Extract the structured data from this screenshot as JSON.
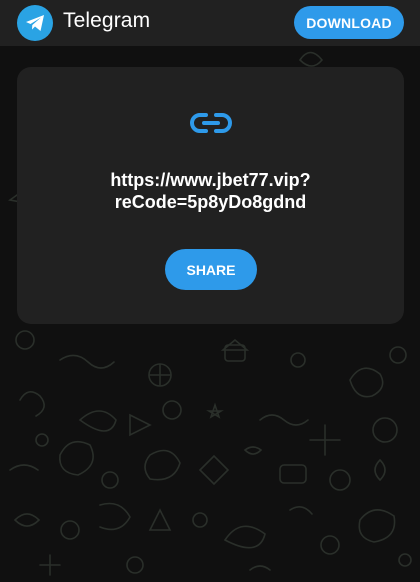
{
  "header": {
    "app_name": "Telegram",
    "download_label": "DOWNLOAD",
    "logo_icon": "telegram-paper-plane-icon"
  },
  "card": {
    "icon": "link-icon",
    "link_line1": "https://www.jbet77.vip?",
    "link_line2": "reCode=5p8yDo8gdnd",
    "share_label": "SHARE"
  },
  "colors": {
    "accent": "#2e9aea",
    "header_bg": "#212121",
    "card_bg": "#212121",
    "page_bg": "#101010"
  }
}
